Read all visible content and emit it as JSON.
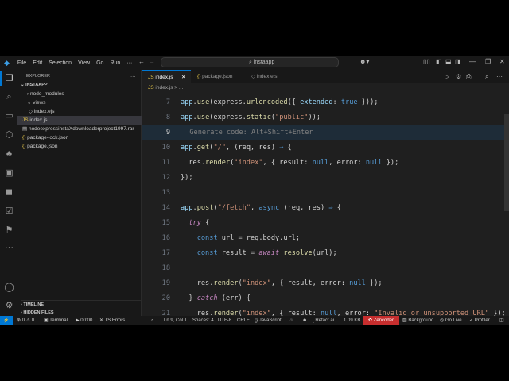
{
  "menu": [
    "File",
    "Edit",
    "Selection",
    "View",
    "Go",
    "Run",
    "···"
  ],
  "search": {
    "value": "instaapp"
  },
  "sidebar": {
    "title": "EXPLORER",
    "root": "INSTAAPP",
    "items": [
      {
        "label": "node_modules",
        "type": "folder-collapsed"
      },
      {
        "label": "views",
        "type": "folder-open"
      },
      {
        "label": "index.ejs",
        "type": "ejs"
      },
      {
        "label": "index.js",
        "type": "js",
        "selected": true
      },
      {
        "label": "nodeexpressinstaXdownloaderproject1997.rar",
        "type": "rar"
      },
      {
        "label": "package-lock.json",
        "type": "json"
      },
      {
        "label": "package.json",
        "type": "json"
      }
    ],
    "timeline": "TIMELINE",
    "hidden": "HIDDEN FILES"
  },
  "tabs": [
    {
      "label": "index.js",
      "active": true
    },
    {
      "label": "package.json"
    },
    {
      "label": "index.ejs"
    }
  ],
  "breadcrumb": "index.js > ...",
  "code": [
    {
      "n": "7",
      "t": [
        [
          "app",
          "v"
        ],
        [
          ".",
          ""
        ],
        [
          "use",
          "f"
        ],
        [
          "(express.",
          ""
        ],
        [
          "urlencoded",
          "f"
        ],
        [
          "({ ",
          ""
        ],
        [
          "extended",
          "v"
        ],
        [
          ": ",
          ""
        ],
        [
          "true",
          "k"
        ],
        [
          " }));",
          ""
        ]
      ]
    },
    {
      "n": "8",
      "t": [
        [
          "app",
          "v"
        ],
        [
          ".",
          ""
        ],
        [
          "use",
          "f"
        ],
        [
          "(express.",
          ""
        ],
        [
          "static",
          "f"
        ],
        [
          "(",
          ""
        ],
        [
          "\"public\"",
          "s"
        ],
        [
          "));",
          ""
        ]
      ]
    },
    {
      "n": "9",
      "t": [
        [
          "  Generate code: Alt+Shift+Enter",
          "c"
        ]
      ]
    },
    {
      "n": "10",
      "t": [
        [
          "app",
          "v"
        ],
        [
          ".",
          ""
        ],
        [
          "get",
          "f"
        ],
        [
          "(",
          ""
        ],
        [
          "\"/\"",
          "s"
        ],
        [
          ", (req, res) ",
          ""
        ],
        [
          "⇒",
          "k"
        ],
        [
          " {",
          ""
        ]
      ]
    },
    {
      "n": "11",
      "t": [
        [
          "  res.",
          ""
        ],
        [
          "render",
          "f"
        ],
        [
          "(",
          ""
        ],
        [
          "\"index\"",
          "s"
        ],
        [
          ", { result: ",
          ""
        ],
        [
          "null",
          "k"
        ],
        [
          ", error: ",
          ""
        ],
        [
          "null",
          "k"
        ],
        [
          " });",
          ""
        ]
      ]
    },
    {
      "n": "12",
      "t": [
        [
          "});",
          ""
        ]
      ]
    },
    {
      "n": "13",
      "t": []
    },
    {
      "n": "14",
      "t": [
        [
          "app",
          "v"
        ],
        [
          ".",
          ""
        ],
        [
          "post",
          "f"
        ],
        [
          "(",
          ""
        ],
        [
          "\"/fetch\"",
          "s"
        ],
        [
          ", ",
          ""
        ],
        [
          "async",
          "k"
        ],
        [
          " (req, res) ",
          ""
        ],
        [
          "⇒",
          "k"
        ],
        [
          " {",
          ""
        ]
      ]
    },
    {
      "n": "15",
      "t": [
        [
          "  ",
          ""
        ],
        [
          "try",
          "kw"
        ],
        [
          " {",
          ""
        ]
      ]
    },
    {
      "n": "16",
      "t": [
        [
          "    ",
          ""
        ],
        [
          "const",
          "k"
        ],
        [
          " url = req.body.url;",
          ""
        ]
      ]
    },
    {
      "n": "17",
      "t": [
        [
          "    ",
          ""
        ],
        [
          "const",
          "k"
        ],
        [
          " result = ",
          ""
        ],
        [
          "await",
          "kw"
        ],
        [
          " ",
          ""
        ],
        [
          "resolve",
          "f"
        ],
        [
          "(url);",
          ""
        ]
      ]
    },
    {
      "n": "18",
      "t": []
    },
    {
      "n": "19",
      "t": [
        [
          "    res.",
          ""
        ],
        [
          "render",
          "f"
        ],
        [
          "(",
          ""
        ],
        [
          "\"index\"",
          "s"
        ],
        [
          ", { result, error: ",
          ""
        ],
        [
          "null",
          "k"
        ],
        [
          " });",
          ""
        ]
      ]
    },
    {
      "n": "20",
      "t": [
        [
          "  } ",
          ""
        ],
        [
          "catch",
          "kw"
        ],
        [
          " (err) {",
          ""
        ]
      ]
    },
    {
      "n": "21",
      "t": [
        [
          "    res.",
          ""
        ],
        [
          "render",
          "f"
        ],
        [
          "(",
          ""
        ],
        [
          "\"index\"",
          "s"
        ],
        [
          ", { result: ",
          ""
        ],
        [
          "null",
          "k"
        ],
        [
          ", error: ",
          ""
        ],
        [
          "\"Invalid or unsupported URL\"",
          "s"
        ],
        [
          " });",
          ""
        ]
      ]
    }
  ],
  "status": {
    "errors": "0",
    "warnings": "0",
    "terminal": "Terminal",
    "timer": "00:00",
    "ts": "TS Errors",
    "position": "Ln 9, Col 1",
    "spaces": "Spaces: 4",
    "encoding": "UTF-8",
    "eol": "CRLF",
    "language": "JavaScript",
    "refact": "Refact.ai",
    "size": "1.09 KB",
    "zencoder": "Zencoder",
    "background": "Background",
    "golive": "Go Live",
    "profiler": "Profiler"
  },
  "colors": {
    "accent": "#0078d4",
    "zencoder": "#c72e2e"
  }
}
